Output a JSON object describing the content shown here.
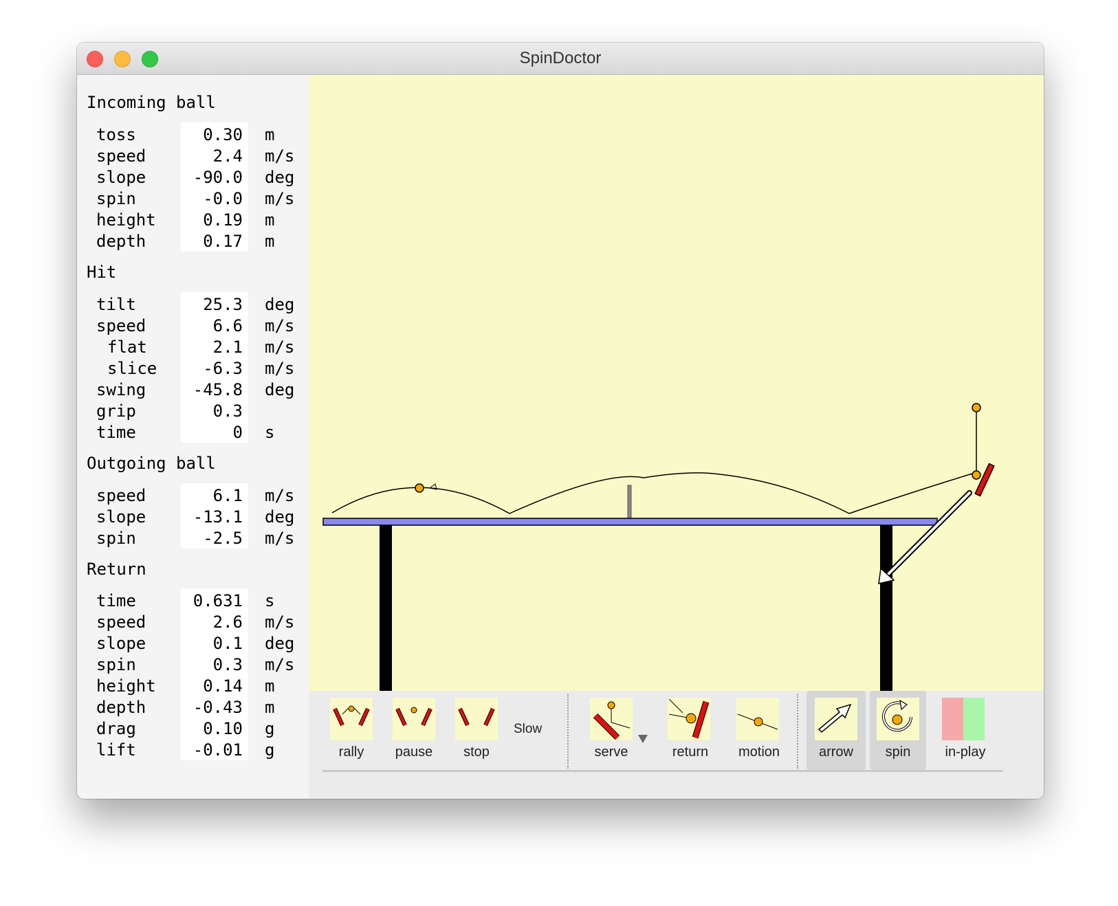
{
  "window": {
    "title": "SpinDoctor"
  },
  "incoming": {
    "heading": "Incoming ball",
    "rows": [
      {
        "label": "toss",
        "value": "0.30",
        "unit": "m"
      },
      {
        "label": "speed",
        "value": "2.4",
        "unit": "m/s"
      },
      {
        "label": "slope",
        "value": "-90.0",
        "unit": "deg"
      },
      {
        "label": "spin",
        "value": "-0.0",
        "unit": "m/s"
      },
      {
        "label": "height",
        "value": "0.19",
        "unit": "m"
      },
      {
        "label": "depth",
        "value": "0.17",
        "unit": "m"
      }
    ]
  },
  "hit": {
    "heading": "Hit",
    "rows": [
      {
        "label": "tilt",
        "value": "25.3",
        "unit": "deg"
      },
      {
        "label": "speed",
        "value": "6.6",
        "unit": "m/s"
      },
      {
        "label": "flat",
        "value": "2.1",
        "unit": "m/s"
      },
      {
        "label": "slice",
        "value": "-6.3",
        "unit": "m/s"
      },
      {
        "label": "swing",
        "value": "-45.8",
        "unit": "deg"
      },
      {
        "label": "grip",
        "value": "0.3",
        "unit": ""
      },
      {
        "label": "time",
        "value": "0",
        "unit": "s"
      }
    ]
  },
  "outgoing": {
    "heading": "Outgoing ball",
    "rows": [
      {
        "label": "speed",
        "value": "6.1",
        "unit": "m/s"
      },
      {
        "label": "slope",
        "value": "-13.1",
        "unit": "deg"
      },
      {
        "label": "spin",
        "value": "-2.5",
        "unit": "m/s"
      }
    ]
  },
  "return": {
    "heading": "Return",
    "rows": [
      {
        "label": "time",
        "value": "0.631",
        "unit": "s"
      },
      {
        "label": "speed",
        "value": "2.6",
        "unit": "m/s"
      },
      {
        "label": "slope",
        "value": "0.1",
        "unit": "deg"
      },
      {
        "label": "spin",
        "value": "0.3",
        "unit": "m/s"
      },
      {
        "label": "height",
        "value": "0.14",
        "unit": "m"
      },
      {
        "label": "depth",
        "value": "-0.43",
        "unit": "m"
      },
      {
        "label": "drag",
        "value": "0.10",
        "unit": "g"
      },
      {
        "label": "lift",
        "value": "-0.01",
        "unit": "g"
      }
    ]
  },
  "toolbar": {
    "rally": "rally",
    "pause": "pause",
    "stop": "stop",
    "slow": "Slow",
    "serve": "serve",
    "return": "return",
    "motion": "motion",
    "arrow": "arrow",
    "spin": "spin",
    "in_play": "in-play"
  },
  "colors": {
    "canvas_bg": "#fafac8",
    "table_top": "#8888ee",
    "table_legs": "#000000",
    "ball": "#f5a800",
    "paddle": "#dd1111",
    "in_play_red": "#f7a8a8",
    "in_play_green": "#a8f7a8"
  }
}
